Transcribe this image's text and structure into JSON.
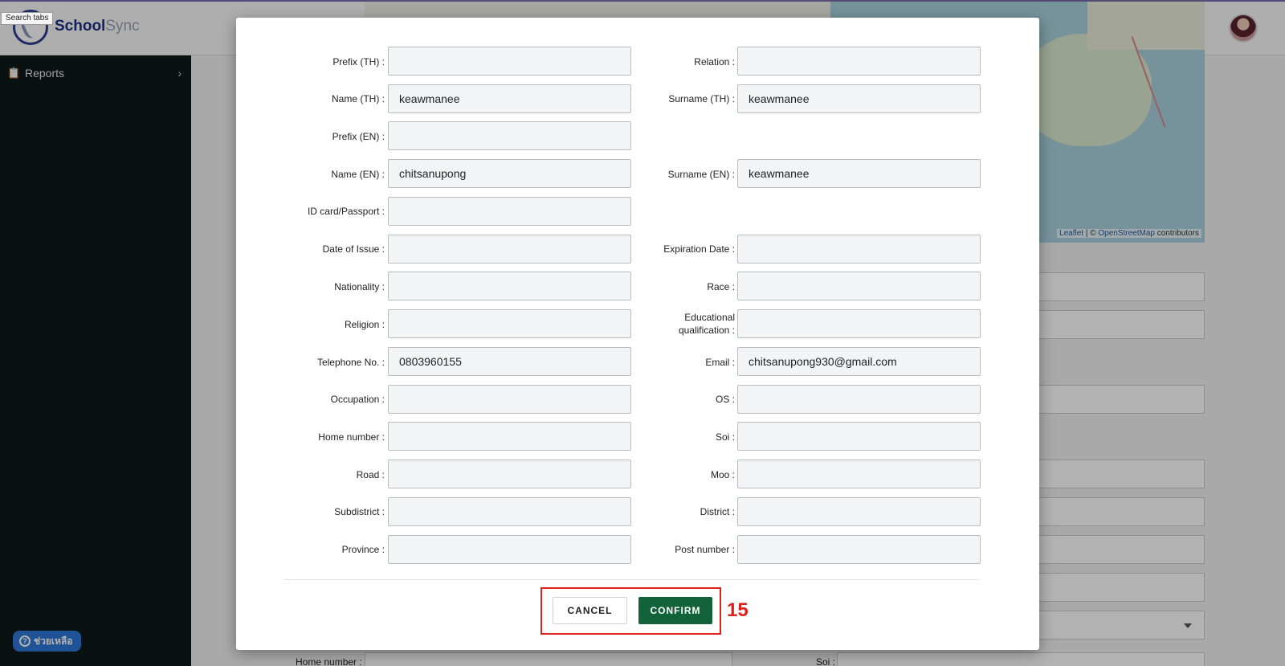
{
  "app": {
    "brand_main": "School",
    "brand_accent": "Sync",
    "search_tabs_tooltip": "Search tabs"
  },
  "sidebar": {
    "items": [
      {
        "label": "Reports",
        "icon": "clipboard-icon"
      }
    ],
    "help_label": "ช่วยเหลือ"
  },
  "map": {
    "attribution_leaflet": "Leaflet",
    "attribution_sep": " | © ",
    "attribution_osm": "OpenStreetMap",
    "attribution_tail": " contributors"
  },
  "background_form": {
    "home_number_label": "Home number :",
    "soi_label": "Soi :"
  },
  "form": {
    "rows": [
      {
        "left": {
          "label": "Prefix (TH) :",
          "value": ""
        },
        "right": {
          "label": "Relation :",
          "value": ""
        }
      },
      {
        "left": {
          "label": "Name (TH) :",
          "value": "keawmanee"
        },
        "right": {
          "label": "Surname (TH) :",
          "value": "keawmanee"
        }
      },
      {
        "left": {
          "label": "Prefix (EN) :",
          "value": ""
        }
      },
      {
        "left": {
          "label": "Name (EN) :",
          "value": "chitsanupong"
        },
        "right": {
          "label": "Surname (EN) :",
          "value": "keawmanee"
        }
      },
      {
        "left": {
          "label": "ID card/Passport :",
          "value": ""
        }
      },
      {
        "left": {
          "label": "Date of Issue :",
          "value": ""
        },
        "right": {
          "label": "Expiration Date :",
          "value": ""
        }
      },
      {
        "left": {
          "label": "Nationality :",
          "value": ""
        },
        "right": {
          "label": "Race :",
          "value": ""
        }
      },
      {
        "left": {
          "label": "Religion :",
          "value": ""
        },
        "right": {
          "label_line1": "Educational",
          "label_line2": "qualification :",
          "value": ""
        }
      },
      {
        "left": {
          "label": "Telephone No. :",
          "value": "0803960155"
        },
        "right": {
          "label": "Email :",
          "value": "chitsanupong930@gmail.com"
        }
      },
      {
        "left": {
          "label": "Occupation :",
          "value": ""
        },
        "right": {
          "label": "OS :",
          "value": ""
        }
      },
      {
        "left": {
          "label": "Home number :",
          "value": ""
        },
        "right": {
          "label": "Soi :",
          "value": ""
        }
      },
      {
        "left": {
          "label": "Road :",
          "value": ""
        },
        "right": {
          "label": "Moo :",
          "value": ""
        }
      },
      {
        "left": {
          "label": "Subdistrict :",
          "value": ""
        },
        "right": {
          "label": "District :",
          "value": ""
        }
      },
      {
        "left": {
          "label": "Province :",
          "value": ""
        },
        "right": {
          "label": "Post number :",
          "value": ""
        }
      }
    ]
  },
  "actions": {
    "cancel_label": "CANCEL",
    "confirm_label": "CONFIRM",
    "annotation_number": "15"
  },
  "colors": {
    "confirm_bg": "#12633a",
    "highlight": "#e0211b",
    "sidebar_bg": "#0e1a18",
    "brand_blue": "#1e2f84"
  }
}
